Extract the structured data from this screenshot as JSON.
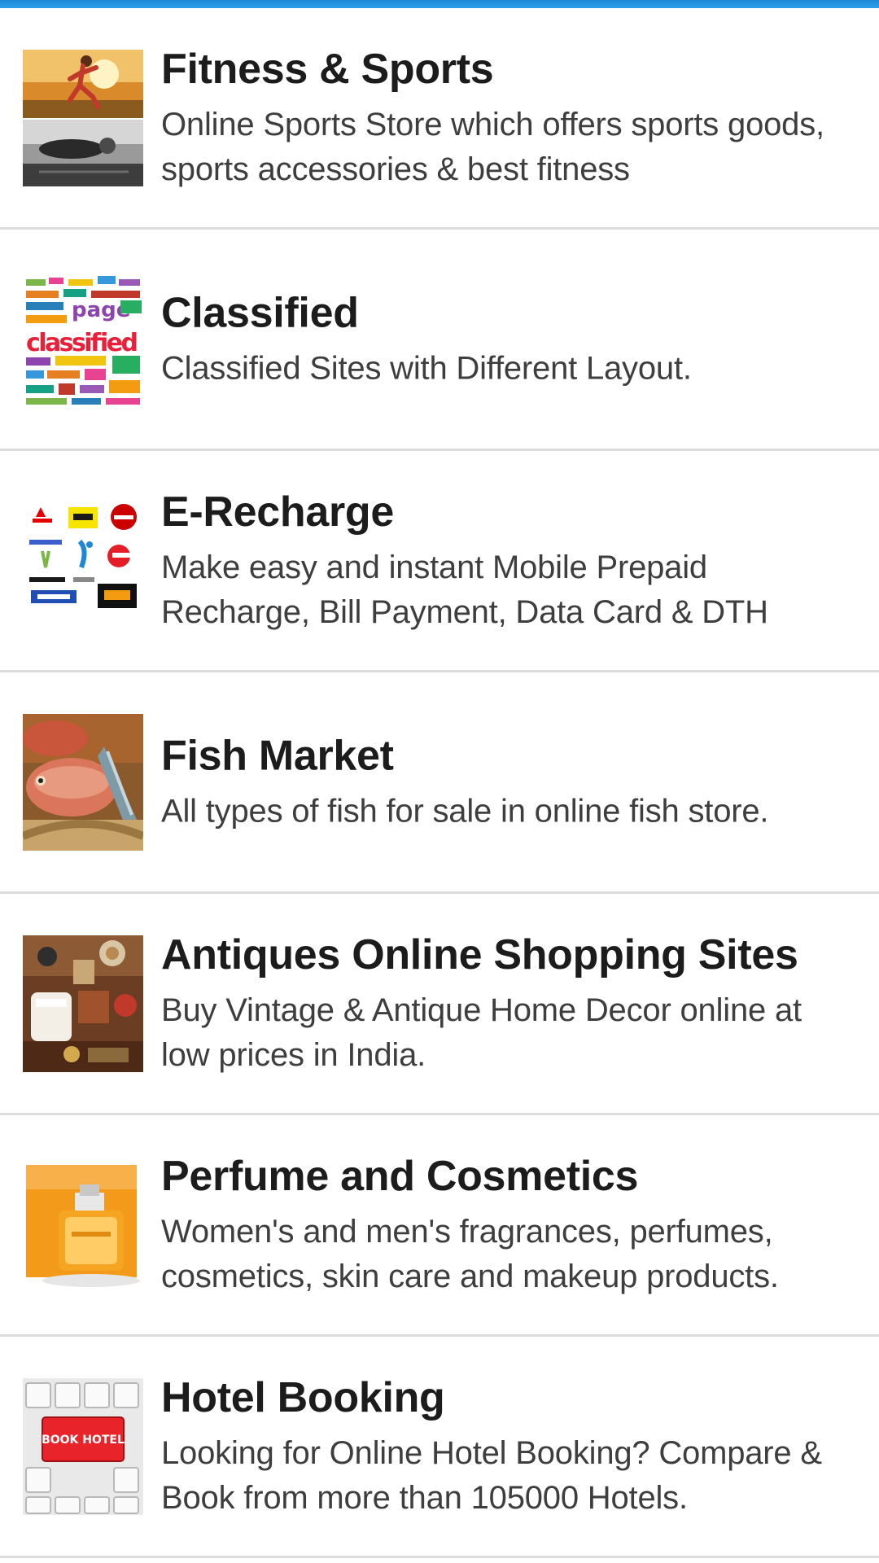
{
  "categories": [
    {
      "title": "Fitness & Sports",
      "description": "Online Sports Store which offers sports goods, sports accessories & best fitness",
      "icon": "fitness-thumbnail"
    },
    {
      "title": "Classified",
      "description": "Classified Sites with Different Layout.",
      "icon": "classified-thumbnail"
    },
    {
      "title": "E-Recharge",
      "description": "Make easy and instant Mobile Prepaid Recharge, Bill Payment, Data Card & DTH",
      "icon": "recharge-thumbnail"
    },
    {
      "title": "Fish Market",
      "description": "All types of fish for sale in online fish store.",
      "icon": "fish-thumbnail"
    },
    {
      "title": "Antiques Online Shopping Sites",
      "description": "Buy Vintage & Antique Home Decor online at low prices in India.",
      "icon": "antiques-thumbnail"
    },
    {
      "title": "Perfume and Cosmetics",
      "description": "Women's and men's fragrances, perfumes, cosmetics, skin care and makeup products.",
      "icon": "perfume-thumbnail"
    },
    {
      "title": "Hotel Booking",
      "description": "Looking for Online Hotel Booking? Compare & Book from more than 105000 Hotels.",
      "icon": "hotel-thumbnail"
    }
  ],
  "thumbnail_text": {
    "classified_word": "classified",
    "classified_page": "page",
    "hotel_key": "BOOK HOTEL"
  },
  "colors": {
    "accent": "#1e88d6",
    "divider": "#dcdcdc",
    "title": "#1c1c1c",
    "description": "#3e3e3e"
  }
}
